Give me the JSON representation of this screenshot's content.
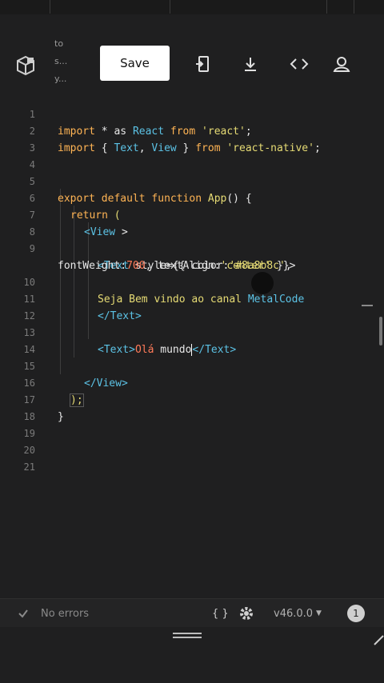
{
  "project": {
    "lines": [
      "to",
      "s...",
      "y..."
    ]
  },
  "toolbar": {
    "save_label": "Save"
  },
  "editor": {
    "line_numbers": [
      "1",
      "2",
      "3",
      "4",
      "5",
      "6",
      "7",
      "8",
      "9",
      "10",
      "11",
      "12",
      "13",
      "14",
      "15",
      "16",
      "17",
      "18",
      "19",
      "20",
      "21"
    ],
    "l1": {
      "a": "import",
      "b": " * as ",
      "c": "React",
      "d": " from ",
      "e": "'react'",
      "f": ";"
    },
    "l2": {
      "a": "import",
      "b": " { ",
      "c": "Text",
      "d": ", ",
      "e": "View",
      "f": " } ",
      "g": "from",
      "h": " ",
      "i": "'react-native'",
      "j": ";"
    },
    "l5": {
      "a": "export",
      "b": " ",
      "c": "default",
      "d": " ",
      "e": "function",
      "f": " ",
      "g": "App",
      "h": "() {"
    },
    "l6": {
      "a": "return",
      "b": " ("
    },
    "l7": {
      "a": "<View",
      "b": " >"
    },
    "l9a": {
      "a": "<Text",
      "b": " style={{ color:",
      "c": "'#8a8b8c'",
      "d": ","
    },
    "l9b": {
      "a": "fontWeight:",
      "b": "700",
      "c": ", textAlign:",
      "d": "'center'",
      "e": " }}>"
    },
    "l10": {
      "a": "Seja Bem vindo ao canal ",
      "b": "MetalCode"
    },
    "l11": {
      "a": "</Text>"
    },
    "l13": {
      "a": "<Text>",
      "b": "Olá",
      "c": " mundo",
      "d": "</Text>"
    },
    "l15": {
      "a": "</View>"
    },
    "l16": {
      "a": ");"
    },
    "l17": {
      "a": "}"
    }
  },
  "status": {
    "errors": "No errors",
    "braces": "{ }",
    "version": "v46.0.0",
    "count": "1"
  },
  "colors": {
    "keyword": "#ffb454",
    "string": "#e6db74",
    "tag": "#5cc3e6",
    "number": "#ff7a59",
    "background": "#1f1f20"
  }
}
